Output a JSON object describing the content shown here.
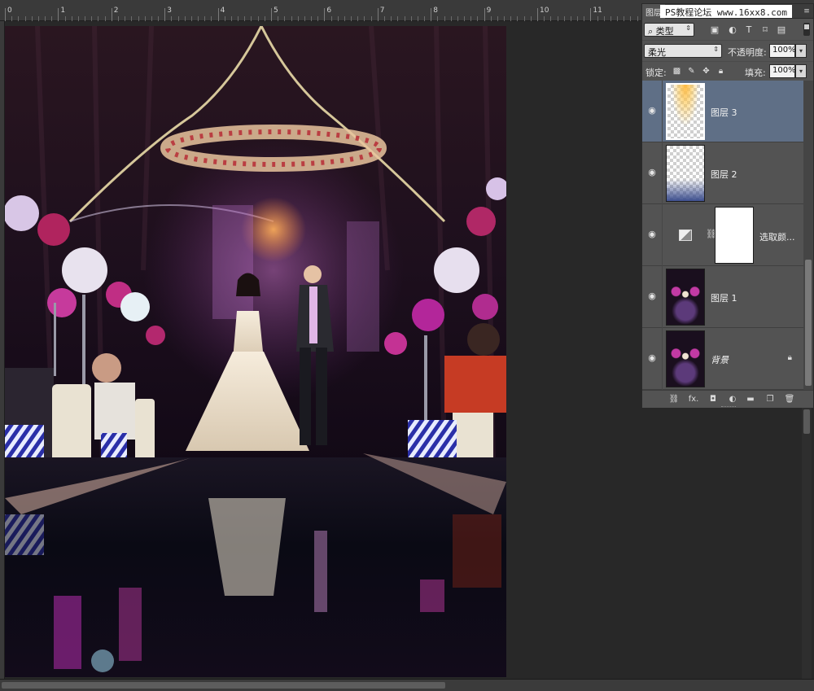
{
  "ruler": {
    "labels": [
      "0",
      "1",
      "2",
      "3",
      "4",
      "5",
      "6",
      "7",
      "8",
      "9",
      "10",
      "11"
    ]
  },
  "watermark": "PS教程论坛 www.16xx8.com",
  "panel": {
    "tab_label": "图层",
    "filter": {
      "value": "类型",
      "icon_label": "⌕"
    },
    "filter_icons": [
      "image-filter-icon",
      "adjustment-filter-icon",
      "type-filter-icon",
      "shape-filter-icon",
      "smart-object-filter-icon"
    ],
    "blend_mode": "柔光",
    "opacity_label": "不透明度:",
    "opacity_value": "100%",
    "lock_label": "锁定:",
    "fill_label": "填充:",
    "fill_value": "100%",
    "layers": [
      {
        "name": "图层 3",
        "selected": true
      },
      {
        "name": "图层 2",
        "selected": false
      },
      {
        "name": "选取颜...",
        "selected": false
      },
      {
        "name": "图层 1",
        "selected": false
      },
      {
        "name": "背景",
        "selected": false,
        "locked": true
      }
    ],
    "footer_icons": [
      "link-layers-icon",
      "fx-icon",
      "add-mask-icon",
      "new-adjustment-icon",
      "new-group-icon",
      "new-layer-icon",
      "delete-layer-icon"
    ],
    "fx_label": "fx."
  },
  "colors": {
    "panel_bg": "#535353",
    "selected_layer": "#5f6f86",
    "workspace_bg": "#282828"
  }
}
